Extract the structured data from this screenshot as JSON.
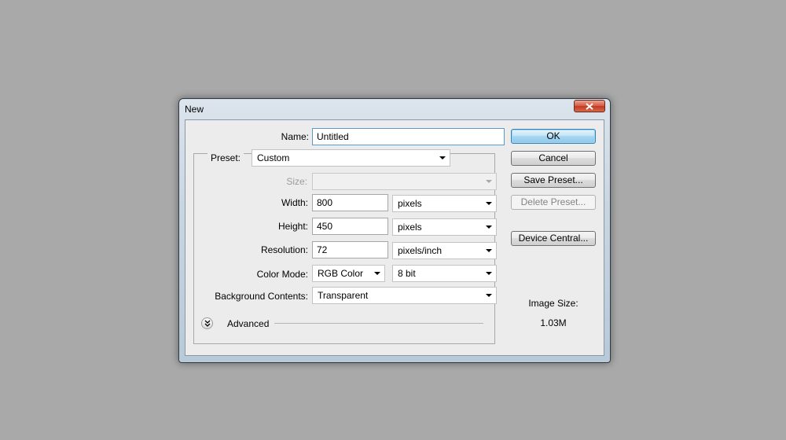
{
  "window": {
    "title": "New"
  },
  "form": {
    "name_label": "Name:",
    "name_value": "Untitled",
    "preset_label": "Preset:",
    "preset_value": "Custom",
    "size_label": "Size:",
    "size_value": "",
    "width_label": "Width:",
    "width_value": "800",
    "width_unit": "pixels",
    "height_label": "Height:",
    "height_value": "450",
    "height_unit": "pixels",
    "resolution_label": "Resolution:",
    "resolution_value": "72",
    "resolution_unit": "pixels/inch",
    "color_mode_label": "Color Mode:",
    "color_mode_value": "RGB Color",
    "bit_depth_value": "8 bit",
    "background_label": "Background Contents:",
    "background_value": "Transparent",
    "advanced_label": "Advanced"
  },
  "buttons": {
    "ok": "OK",
    "cancel": "Cancel",
    "save_preset": "Save Preset...",
    "delete_preset": "Delete Preset...",
    "device_central": "Device Central..."
  },
  "info": {
    "image_size_label": "Image Size:",
    "image_size_value": "1.03M"
  },
  "icons": {
    "close": "close-icon",
    "advanced": "expand-chevrons-icon",
    "dropdown": "chevron-down-icon"
  },
  "colors": {
    "desktop": "#a9a9a9",
    "dialog_body": "#ececec",
    "default_button": "#a6d6f1",
    "close_button": "#d6563d"
  }
}
